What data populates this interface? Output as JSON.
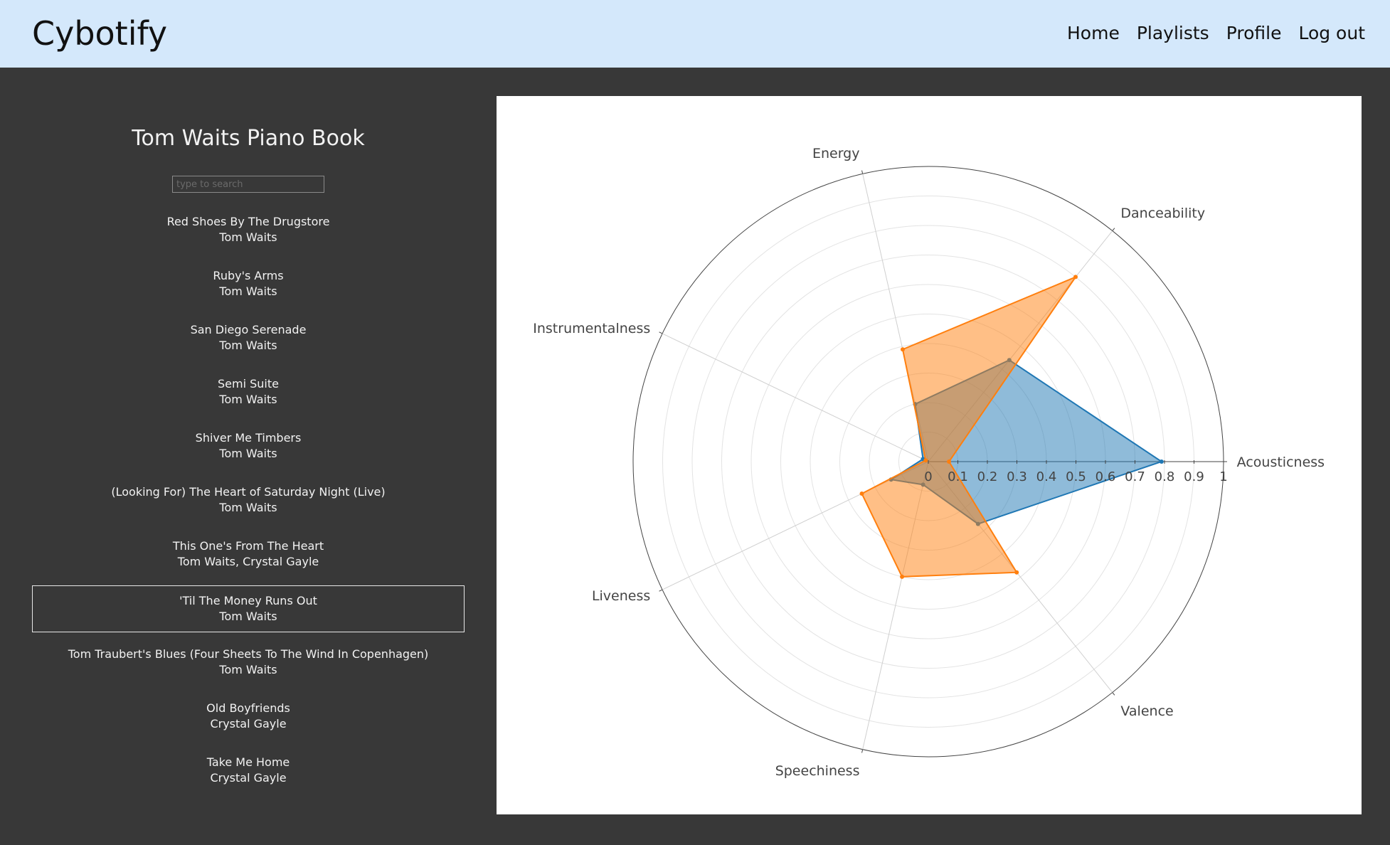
{
  "app": {
    "title": "Cybotify"
  },
  "nav": {
    "items": [
      "Home",
      "Playlists",
      "Profile",
      "Log out"
    ]
  },
  "playlist": {
    "title": "Tom Waits Piano Book",
    "search_placeholder": "type to search",
    "selected_index": 7,
    "tracks": [
      {
        "title": "Red Shoes By The Drugstore",
        "artist": "Tom Waits"
      },
      {
        "title": "Ruby's Arms",
        "artist": "Tom Waits"
      },
      {
        "title": "San Diego Serenade",
        "artist": "Tom Waits"
      },
      {
        "title": "Semi Suite",
        "artist": "Tom Waits"
      },
      {
        "title": "Shiver Me Timbers",
        "artist": "Tom Waits"
      },
      {
        "title": "(Looking For) The Heart of Saturday Night (Live)",
        "artist": "Tom Waits"
      },
      {
        "title": "This One's From The Heart",
        "artist": "Tom Waits, Crystal Gayle"
      },
      {
        "title": "'Til The Money Runs Out",
        "artist": "Tom Waits"
      },
      {
        "title": "Tom Traubert's Blues (Four Sheets To The Wind In Copenhagen)",
        "artist": "Tom Waits"
      },
      {
        "title": "Old Boyfriends",
        "artist": "Crystal Gayle"
      },
      {
        "title": "Take Me Home",
        "artist": "Crystal Gayle"
      }
    ]
  },
  "chart_data": {
    "type": "radar",
    "axes": [
      "Acousticness",
      "Danceability",
      "Energy",
      "Instrumentalness",
      "Liveness",
      "Speechiness",
      "Valence"
    ],
    "radial_ticks": [
      "0",
      "0.1",
      "0.2",
      "0.3",
      "0.4",
      "0.5",
      "0.6",
      "0.7",
      "0.8",
      "0.9",
      "1"
    ],
    "range": [
      0,
      1
    ],
    "series": [
      {
        "color": "#1f77b4",
        "fill": "rgba(31,119,180,0.5)",
        "values": [
          0.79,
          0.44,
          0.2,
          0.02,
          0.14,
          0.08,
          0.27
        ]
      },
      {
        "color": "#ff7f0e",
        "fill": "rgba(255,127,14,0.5)",
        "values": [
          0.07,
          0.8,
          0.39,
          0.01,
          0.25,
          0.4,
          0.48
        ]
      }
    ]
  }
}
